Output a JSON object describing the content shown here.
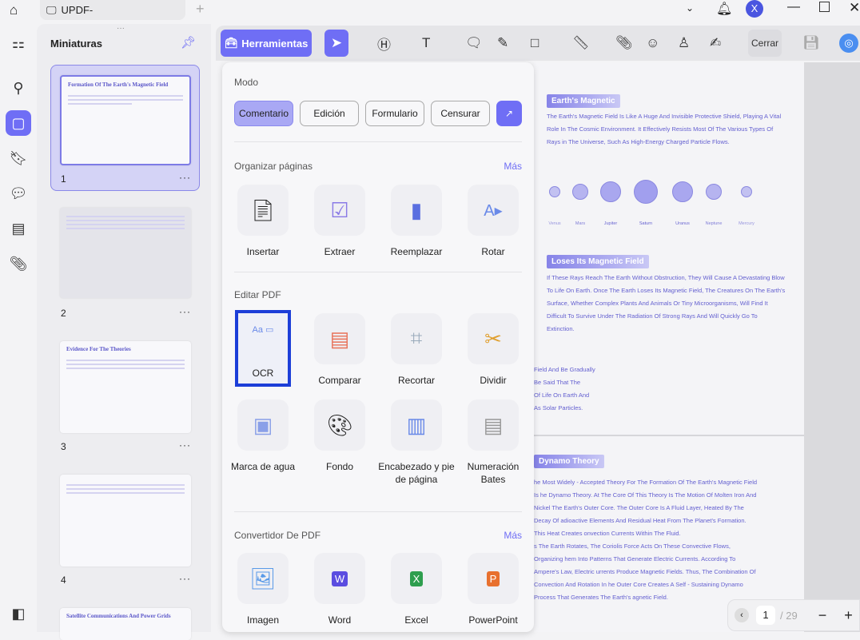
{
  "titlebar": {
    "tab_title": "UPDF-",
    "avatar_letter": "X"
  },
  "sidebar": {
    "title": "Miniaturas",
    "pages": [
      {
        "num": "1",
        "title": "Formation Of The Earth's Magnetic Field"
      },
      {
        "num": "2",
        "title": ""
      },
      {
        "num": "3",
        "title": "Evidence For The Theories"
      },
      {
        "num": "4",
        "title": ""
      },
      {
        "num": "",
        "title": "Satellite Communications And Power Grids"
      }
    ]
  },
  "toolbar": {
    "tools_label": "Herramientas",
    "close_label": "Cerrar"
  },
  "panel": {
    "mode_label": "Modo",
    "modes": [
      "Comentario",
      "Edición",
      "Formulario",
      "Censurar"
    ],
    "organize": {
      "label": "Organizar páginas",
      "more": "Más",
      "items": [
        "Insertar",
        "Extraer",
        "Reemplazar",
        "Rotar"
      ]
    },
    "edit": {
      "label": "Editar PDF",
      "items": [
        "OCR",
        "Comparar",
        "Recortar",
        "Dividir",
        "Marca de agua",
        "Fondo",
        "Encabezado y pie de página",
        "Numeración Bates"
      ]
    },
    "convert": {
      "label": "Convertidor De PDF",
      "more": "Más",
      "items": [
        "Imagen",
        "Word",
        "Excel",
        "PowerPoint"
      ]
    }
  },
  "document": {
    "h1": "Earth's Magnetic",
    "p1": "The Earth's Magnetic Field Is Like A Huge And Invisible Protective Shield, Playing A Vital Role In The Cosmic Environment. It Effectively Resists Most Of The Various Types Of Rays in The Universe, Such As High-Energy Charged Particle Flows.",
    "planets": [
      "Venus",
      "Mars",
      "Jupiter",
      "Saturn",
      "Uranus",
      "Neptune",
      "Mercury"
    ],
    "h2": "Loses Its Magnetic Field",
    "p2": "If These Rays Reach The Earth Without Obstruction, They Will Cause A Devastating Blow To Life On Earth. Once The Earth Loses Its Magnetic Field, The Creatures On The Earth's Surface, Whether Complex Plants And Animals Or Tiny Microorganisms, Will Find It Difficult To Survive Under The Radiation Of Strong Rays And Will Quickly Go To Extinction.",
    "p3": "Field And Be Gradually\nBe Said That The\nOf Life On Earth And\nAs Solar Particles.",
    "h3": "Dynamo Theory",
    "p4": "he Most Widely - Accepted Theory For The Formation Of The Earth's Magnetic Field Is he Dynamo Theory. At The Core Of This Theory Is The Motion Of Molten Iron And Nickel The Earth's Outer Core. The Outer Core Is A Fluid Layer, Heated By The Decay Of adioactive Elements And Residual Heat From The Planet's Formation. This Heat Creates onvection Currents Within The Fluid.",
    "p5": "s The Earth Rotates, The Coriolis Force Acts On These Convective Flows, Organizing hem Into Patterns That Generate Electric Currents. According To Ampere's Law, Electric urrents Produce Magnetic Fields. Thus, The Combination Of Convection And Rotation In he Outer Core Creates A Self - Sustaining Dynamo Process That Generates The Earth's agnetic Field."
  },
  "pager": {
    "current": "1",
    "total": "/ 29"
  },
  "colors": {
    "accent": "#6f6ef5",
    "doc_text": "#6460d0"
  }
}
